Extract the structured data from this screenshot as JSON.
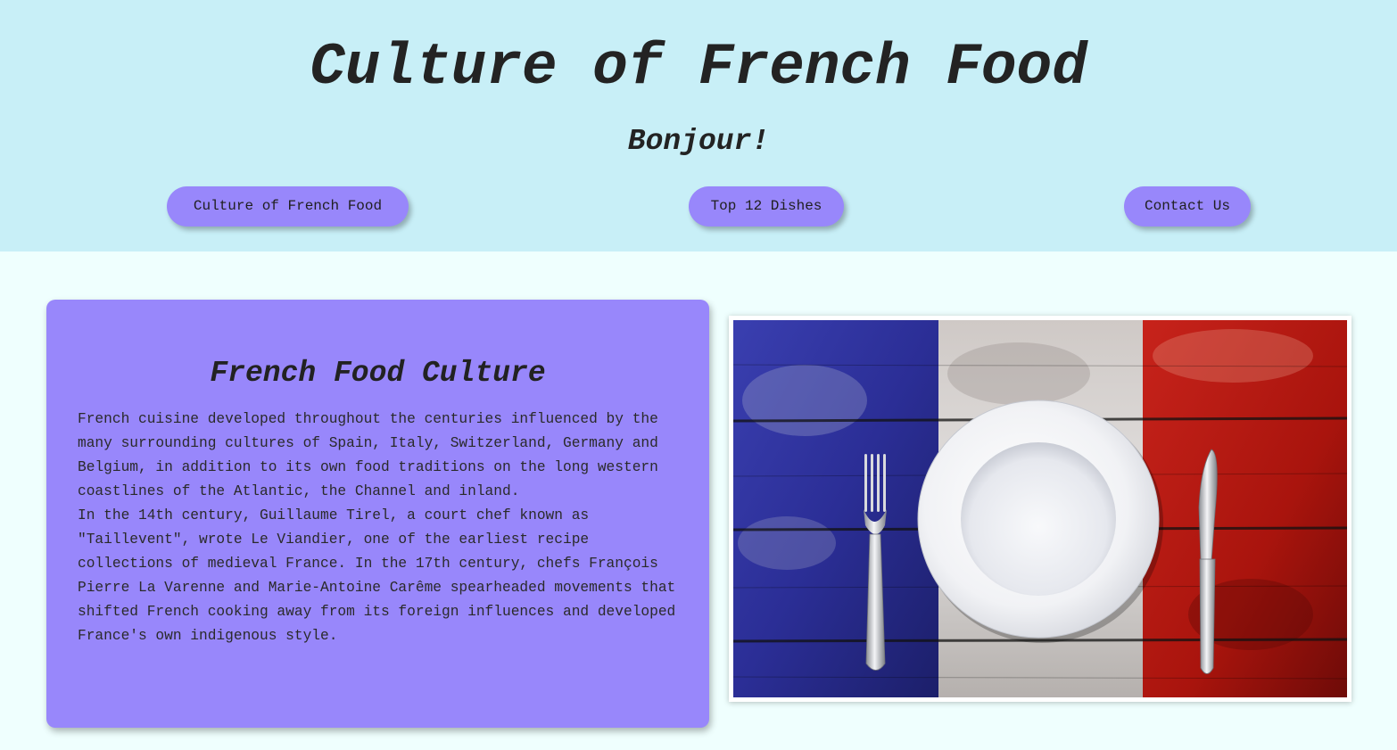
{
  "header": {
    "title": "Culture of French Food",
    "greeting": "Bonjour!",
    "nav": [
      {
        "label": "Culture of French Food"
      },
      {
        "label": "Top 12 Dishes"
      },
      {
        "label": "Contact Us"
      }
    ]
  },
  "culture_section": {
    "heading": "French Food Culture",
    "paragraphs": [
      "French cuisine developed throughout the centuries influenced by the many surrounding cultures of Spain, Italy, Switzerland, Germany and Belgium, in addition to its own food traditions on the long western coastlines of the Atlantic, the Channel and inland.",
      "In the 14th century, Guillaume Tirel, a court chef known as \"Taillevent\", wrote Le Viandier, one of the earliest recipe collections of medieval France. In the 17th century, chefs François Pierre La Varenne and Marie-Antoine Carême spearheaded movements that shifted French cooking away from its foreign influences and developed France's own indigenous style."
    ]
  },
  "photo": {
    "description_icon": "plate-fork-knife-french-flag-image"
  },
  "colors": {
    "header_bg": "#c8eff7",
    "page_bg": "#effffe",
    "accent": "#9887fb",
    "flag_blue": "#2d2f9e",
    "flag_white": "#d8d6d6",
    "flag_red": "#b3170f"
  }
}
